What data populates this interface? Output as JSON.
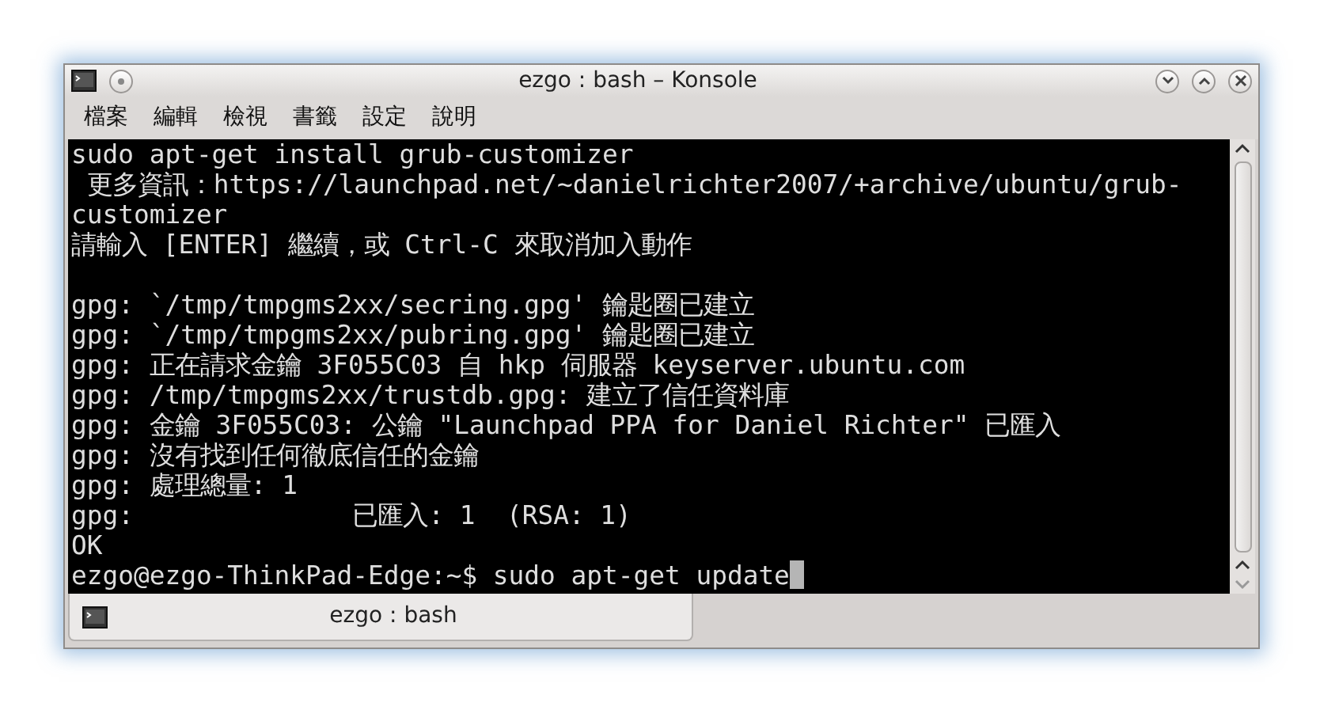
{
  "window": {
    "title": "ezgo : bash – Konsole"
  },
  "menu": [
    "檔案",
    "編輯",
    "檢視",
    "書籤",
    "設定",
    "說明"
  ],
  "terminal": {
    "lines": [
      {
        "text": "sudo apt-get install grub-customizer"
      },
      {
        "text": " 更多資訊：https://launchpad.net/~danielrichter2007/+archive/ubuntu/grub-"
      },
      {
        "text": "customizer"
      },
      {
        "text": "請輸入 [ENTER] 繼續，或 Ctrl-C 來取消加入動作"
      },
      {
        "text": "gpg: `/tmp/tmpgms2xx/secring.gpg' 鑰匙圈已建立",
        "gap_before": true
      },
      {
        "text": "gpg: `/tmp/tmpgms2xx/pubring.gpg' 鑰匙圈已建立"
      },
      {
        "text": "gpg: 正在請求金鑰 3F055C03 自 hkp 伺服器 keyserver.ubuntu.com"
      },
      {
        "text": "gpg: /tmp/tmpgms2xx/trustdb.gpg: 建立了信任資料庫"
      },
      {
        "text": "gpg: 金鑰 3F055C03: 公鑰 \"Launchpad PPA for Daniel Richter\" 已匯入"
      },
      {
        "text": "gpg: 沒有找到任何徹底信任的金鑰"
      },
      {
        "text": "gpg: 處理總量: 1"
      },
      {
        "text": "gpg:              已匯入: 1  (RSA: 1)"
      },
      {
        "text": "OK"
      },
      {
        "text": "ezgo@ezgo-ThinkPad-Edge:~$ sudo apt-get update",
        "cursor": true
      }
    ]
  },
  "tabs": [
    {
      "label": "ezgo : bash",
      "selected": true
    }
  ]
}
